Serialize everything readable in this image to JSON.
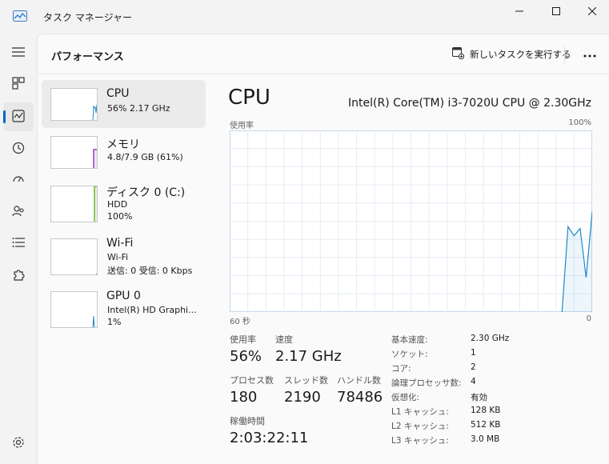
{
  "window": {
    "title": "タスク マネージャー"
  },
  "header": {
    "title": "パフォーマンス",
    "run_new_task": "新しいタスクを実行する"
  },
  "nav": {
    "items": [
      {
        "name": "hamburger-menu",
        "icon": "hamburger-icon"
      },
      {
        "name": "processes",
        "icon": "processes-icon"
      },
      {
        "name": "performance",
        "icon": "performance-icon",
        "active": true
      },
      {
        "name": "app-history",
        "icon": "history-icon"
      },
      {
        "name": "startup-apps",
        "icon": "startup-icon"
      },
      {
        "name": "users",
        "icon": "users-icon"
      },
      {
        "name": "details",
        "icon": "list-icon"
      },
      {
        "name": "services",
        "icon": "puzzle-icon"
      },
      {
        "name": "settings",
        "icon": "gear-icon"
      }
    ]
  },
  "devices": [
    {
      "name": "CPU",
      "line1": "56%  2.17 GHz",
      "line2": "",
      "line3": "",
      "color": "#1f89c9",
      "selected": true
    },
    {
      "name": "メモリ",
      "line1": "4.8/7.9 GB (61%)",
      "line2": "",
      "line3": "",
      "color": "#8b12ae"
    },
    {
      "name": "ディスク 0 (C:)",
      "line1": "HDD",
      "line2": "100%",
      "line3": "",
      "color": "#4da60c"
    },
    {
      "name": "Wi-Fi",
      "line1": "Wi-Fi",
      "line2": "送信: 0 受信: 0 Kbps",
      "line3": "",
      "color": "#a74f01"
    },
    {
      "name": "GPU 0",
      "line1": "Intel(R) HD Graphi...",
      "line2": "1%",
      "line3": "",
      "color": "#1f89c9"
    }
  ],
  "detail": {
    "title": "CPU",
    "model": "Intel(R) Core(TM) i3-7020U CPU @ 2.30GHz",
    "graph_label": "使用率",
    "graph_max": "100%",
    "graph_time": "60 秒",
    "graph_min": "0",
    "stats": {
      "usage_label": "使用率",
      "usage_value": "56%",
      "speed_label": "速度",
      "speed_value": "2.17 GHz",
      "processes_label": "プロセス数",
      "processes_value": "180",
      "threads_label": "スレッド数",
      "threads_value": "2190",
      "handles_label": "ハンドル数",
      "handles_value": "78486",
      "uptime_label": "稼働時間",
      "uptime_value": "2:03:22:11"
    },
    "specs": [
      {
        "key": "基本速度:",
        "value": "2.30 GHz"
      },
      {
        "key": "ソケット:",
        "value": "1"
      },
      {
        "key": "コア:",
        "value": "2"
      },
      {
        "key": "論理プロセッサ数:",
        "value": "4"
      },
      {
        "key": "仮想化:",
        "value": "有効"
      },
      {
        "key": "L1 キャッシュ:",
        "value": "128 KB"
      },
      {
        "key": "L2 キャッシュ:",
        "value": "512 KB"
      },
      {
        "key": "L3 キャッシュ:",
        "value": "3.0 MB"
      }
    ]
  },
  "chart_data": {
    "type": "area",
    "x_range_seconds": [
      60,
      0
    ],
    "ylim": [
      0,
      100
    ],
    "grid": true,
    "color": "#1f89c9",
    "series": [
      {
        "x": [
          0,
          1,
          2,
          3,
          4,
          5,
          6,
          7,
          8,
          9,
          10,
          11,
          12,
          13,
          14,
          15,
          16,
          17,
          18,
          19,
          20,
          21,
          22,
          23,
          24,
          25,
          26,
          27,
          28,
          29,
          30,
          31,
          32,
          33,
          34,
          35,
          36,
          37,
          38,
          39,
          40,
          41,
          42,
          43,
          44,
          45,
          46,
          47,
          48,
          49,
          50,
          51,
          52,
          53,
          54,
          55,
          56,
          57,
          58,
          59,
          60
        ],
        "values": [
          0,
          0,
          0,
          0,
          0,
          0,
          0,
          0,
          0,
          0,
          0,
          0,
          0,
          0,
          0,
          0,
          0,
          0,
          0,
          0,
          0,
          0,
          0,
          0,
          0,
          0,
          0,
          0,
          0,
          0,
          0,
          0,
          0,
          0,
          0,
          0,
          0,
          0,
          0,
          0,
          0,
          0,
          0,
          0,
          0,
          0,
          0,
          0,
          0,
          0,
          0,
          0,
          0,
          0,
          0,
          0,
          47,
          42,
          46,
          19,
          55
        ]
      }
    ]
  }
}
